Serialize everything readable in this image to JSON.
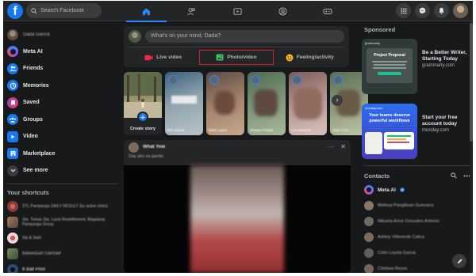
{
  "topbar": {
    "logo_letter": "f",
    "search_placeholder": "Search Facebook",
    "nav_tabs": [
      {
        "name": "home-icon",
        "active": true
      },
      {
        "name": "friends-icon",
        "active": false
      },
      {
        "name": "watch-icon",
        "active": false
      },
      {
        "name": "groups-icon",
        "active": false
      },
      {
        "name": "gaming-icon",
        "active": false
      }
    ],
    "right_icons": [
      "menu-grid-icon",
      "messenger-icon",
      "bell-icon",
      "account-avatar"
    ]
  },
  "left_sidebar": {
    "profile_name": "Dada Garcia",
    "items": [
      {
        "label": "Meta AI",
        "icon": "meta-ai-icon",
        "color": "#8a5cf6"
      },
      {
        "label": "Friends",
        "icon": "friends-icon",
        "color": "#1877f2"
      },
      {
        "label": "Memories",
        "icon": "memories-icon",
        "color": "#1877f2"
      },
      {
        "label": "Saved",
        "icon": "saved-icon",
        "color": "#c13584"
      },
      {
        "label": "Groups",
        "icon": "groups-icon",
        "color": "#1877f2"
      },
      {
        "label": "Video",
        "icon": "video-icon",
        "color": "#1877f2"
      },
      {
        "label": "Marketplace",
        "icon": "marketplace-icon",
        "color": "#1877f2"
      },
      {
        "label": "See more",
        "icon": "chevron-down-icon",
        "color": "#3a3b3c"
      }
    ],
    "shortcuts_title": "Your shortcuts",
    "shortcuts": [
      {
        "label": "STL Pampanga DAILY RESULT (by active vloks)",
        "color": "#8c3b3b"
      },
      {
        "label": "Sto. Tomas Sta. Lucia Resettlement, Magalang Pampanga Group",
        "color": "#7a5d45"
      },
      {
        "label": "Sip & Swirl",
        "color": "#c9b8b0"
      },
      {
        "label": "BARANGAY DAPDAP",
        "color": "#5d6b4d"
      },
      {
        "label": "8 Ball Pool",
        "color": "#2e4a7a"
      }
    ]
  },
  "composer": {
    "placeholder": "What's on your mind, Dada?",
    "actions": [
      {
        "label": "Live video",
        "icon": "live-video-icon",
        "color": "#f02849",
        "highlighted": false
      },
      {
        "label": "Photo/video",
        "icon": "photo-video-icon",
        "color": "#45bd62",
        "highlighted": true
      },
      {
        "label": "Feeling/activity",
        "icon": "feeling-icon",
        "color": "#f7b928",
        "highlighted": false
      }
    ]
  },
  "stories": {
    "create_label": "Create story",
    "items": [
      {
        "name": "Mia Garcia",
        "c1": "#3b5f78",
        "c2": "#b9c3c7"
      },
      {
        "name": "Mark Lopez",
        "c1": "#5b4b45",
        "c2": "#c9a78e"
      },
      {
        "name": "Shaina Pineda",
        "c1": "#4e6b52",
        "c2": "#a9b79a"
      },
      {
        "name": "Lea Navarro",
        "c1": "#7d5a56",
        "c2": "#d7c3bc"
      },
      {
        "name": "Joan Cruz",
        "c1": "#5a6e53",
        "c2": "#bfc7a8"
      }
    ]
  },
  "post": {
    "author": "What Yow",
    "text": "Day ako sa ganito",
    "more_label": "···",
    "close_label": "✕"
  },
  "right_sidebar": {
    "sponsored_title": "Sponsored",
    "ads": [
      {
        "title": "Be a Better Writer, Starting Today",
        "domain": "grammarly.com",
        "image_heading": "Project Proposal",
        "brand": "grammarly"
      },
      {
        "title": "Start your free account today",
        "domain": "monday.com",
        "image_heading": "Your teams deserve powerful workflows",
        "brand": "monday.com"
      }
    ],
    "contacts_title": "Contacts",
    "contacts": [
      {
        "name": "Meta AI",
        "verified": true,
        "color": "#6e4bd8"
      },
      {
        "name": "Melissa Pangilinan Guevarra",
        "color": "#8b7765"
      },
      {
        "name": "Mikaela Anne Gonzales Antonio",
        "color": "#6d6a62"
      },
      {
        "name": "Ashley Villaverde Calica",
        "color": "#7c6a5a"
      },
      {
        "name": "Cielo Loyola Garcia",
        "color": "#5e5a66"
      },
      {
        "name": "Chelsea Reyes",
        "color": "#77645a"
      }
    ]
  }
}
